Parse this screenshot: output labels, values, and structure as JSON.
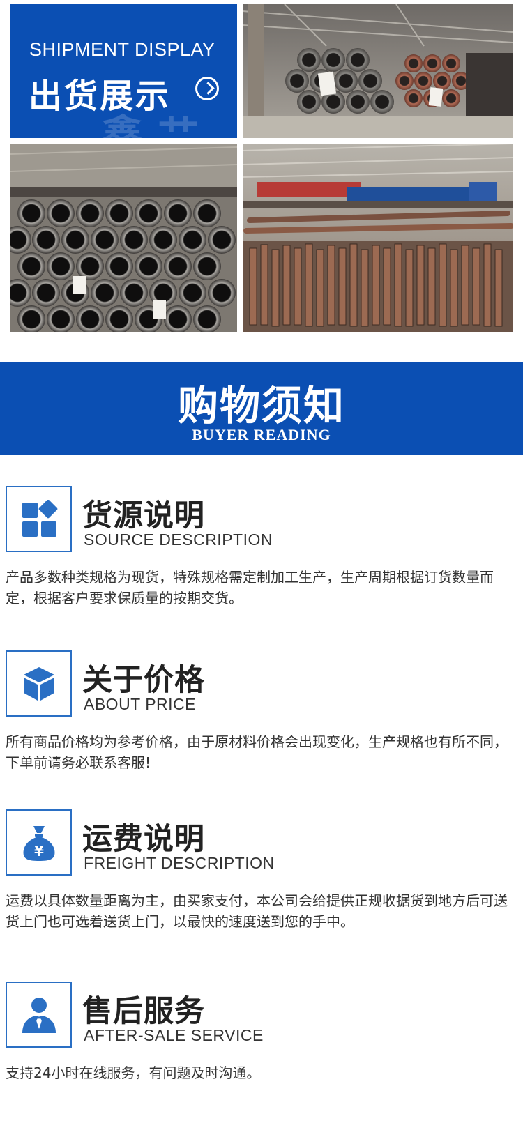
{
  "shipment": {
    "title_en": "SHIPMENT DISPLAY",
    "title_cn": "出货展示"
  },
  "buyer_reading": {
    "title_cn": "购物须知",
    "title_en": "BUYER READING"
  },
  "notices": [
    {
      "icon": "grid-blocks-icon",
      "title": "货源说明",
      "subtitle": "SOURCE DESCRIPTION",
      "text": "产品多数种类规格为现货，特殊规格需定制加工生产，生产周期根据订货数量而定，根据客户要求保质量的按期交货。"
    },
    {
      "icon": "cube-icon",
      "title": "关于价格",
      "subtitle": "ABOUT PRICE",
      "text": "所有商品价格均为参考价格，由于原材料价格会出现变化，生产规格也有所不同，下单前请务必联系客服!"
    },
    {
      "icon": "money-bag-icon",
      "title": "运费说明",
      "subtitle": "FREIGHT DESCRIPTION",
      "text": "运费以具体数量距离为主，由买家支付，本公司会给提供正规收据货到地方后可送货上门也可选着送货上门，以最快的速度送到您的手中。"
    },
    {
      "icon": "service-person-icon",
      "title": "售后服务",
      "subtitle": "AFTER-SALE SERVICE",
      "text": "支持24小时在线服务，有问题及时沟通。"
    }
  ],
  "colors": {
    "brand_blue": "#0b4fb3",
    "icon_blue": "#2a6fc4"
  }
}
